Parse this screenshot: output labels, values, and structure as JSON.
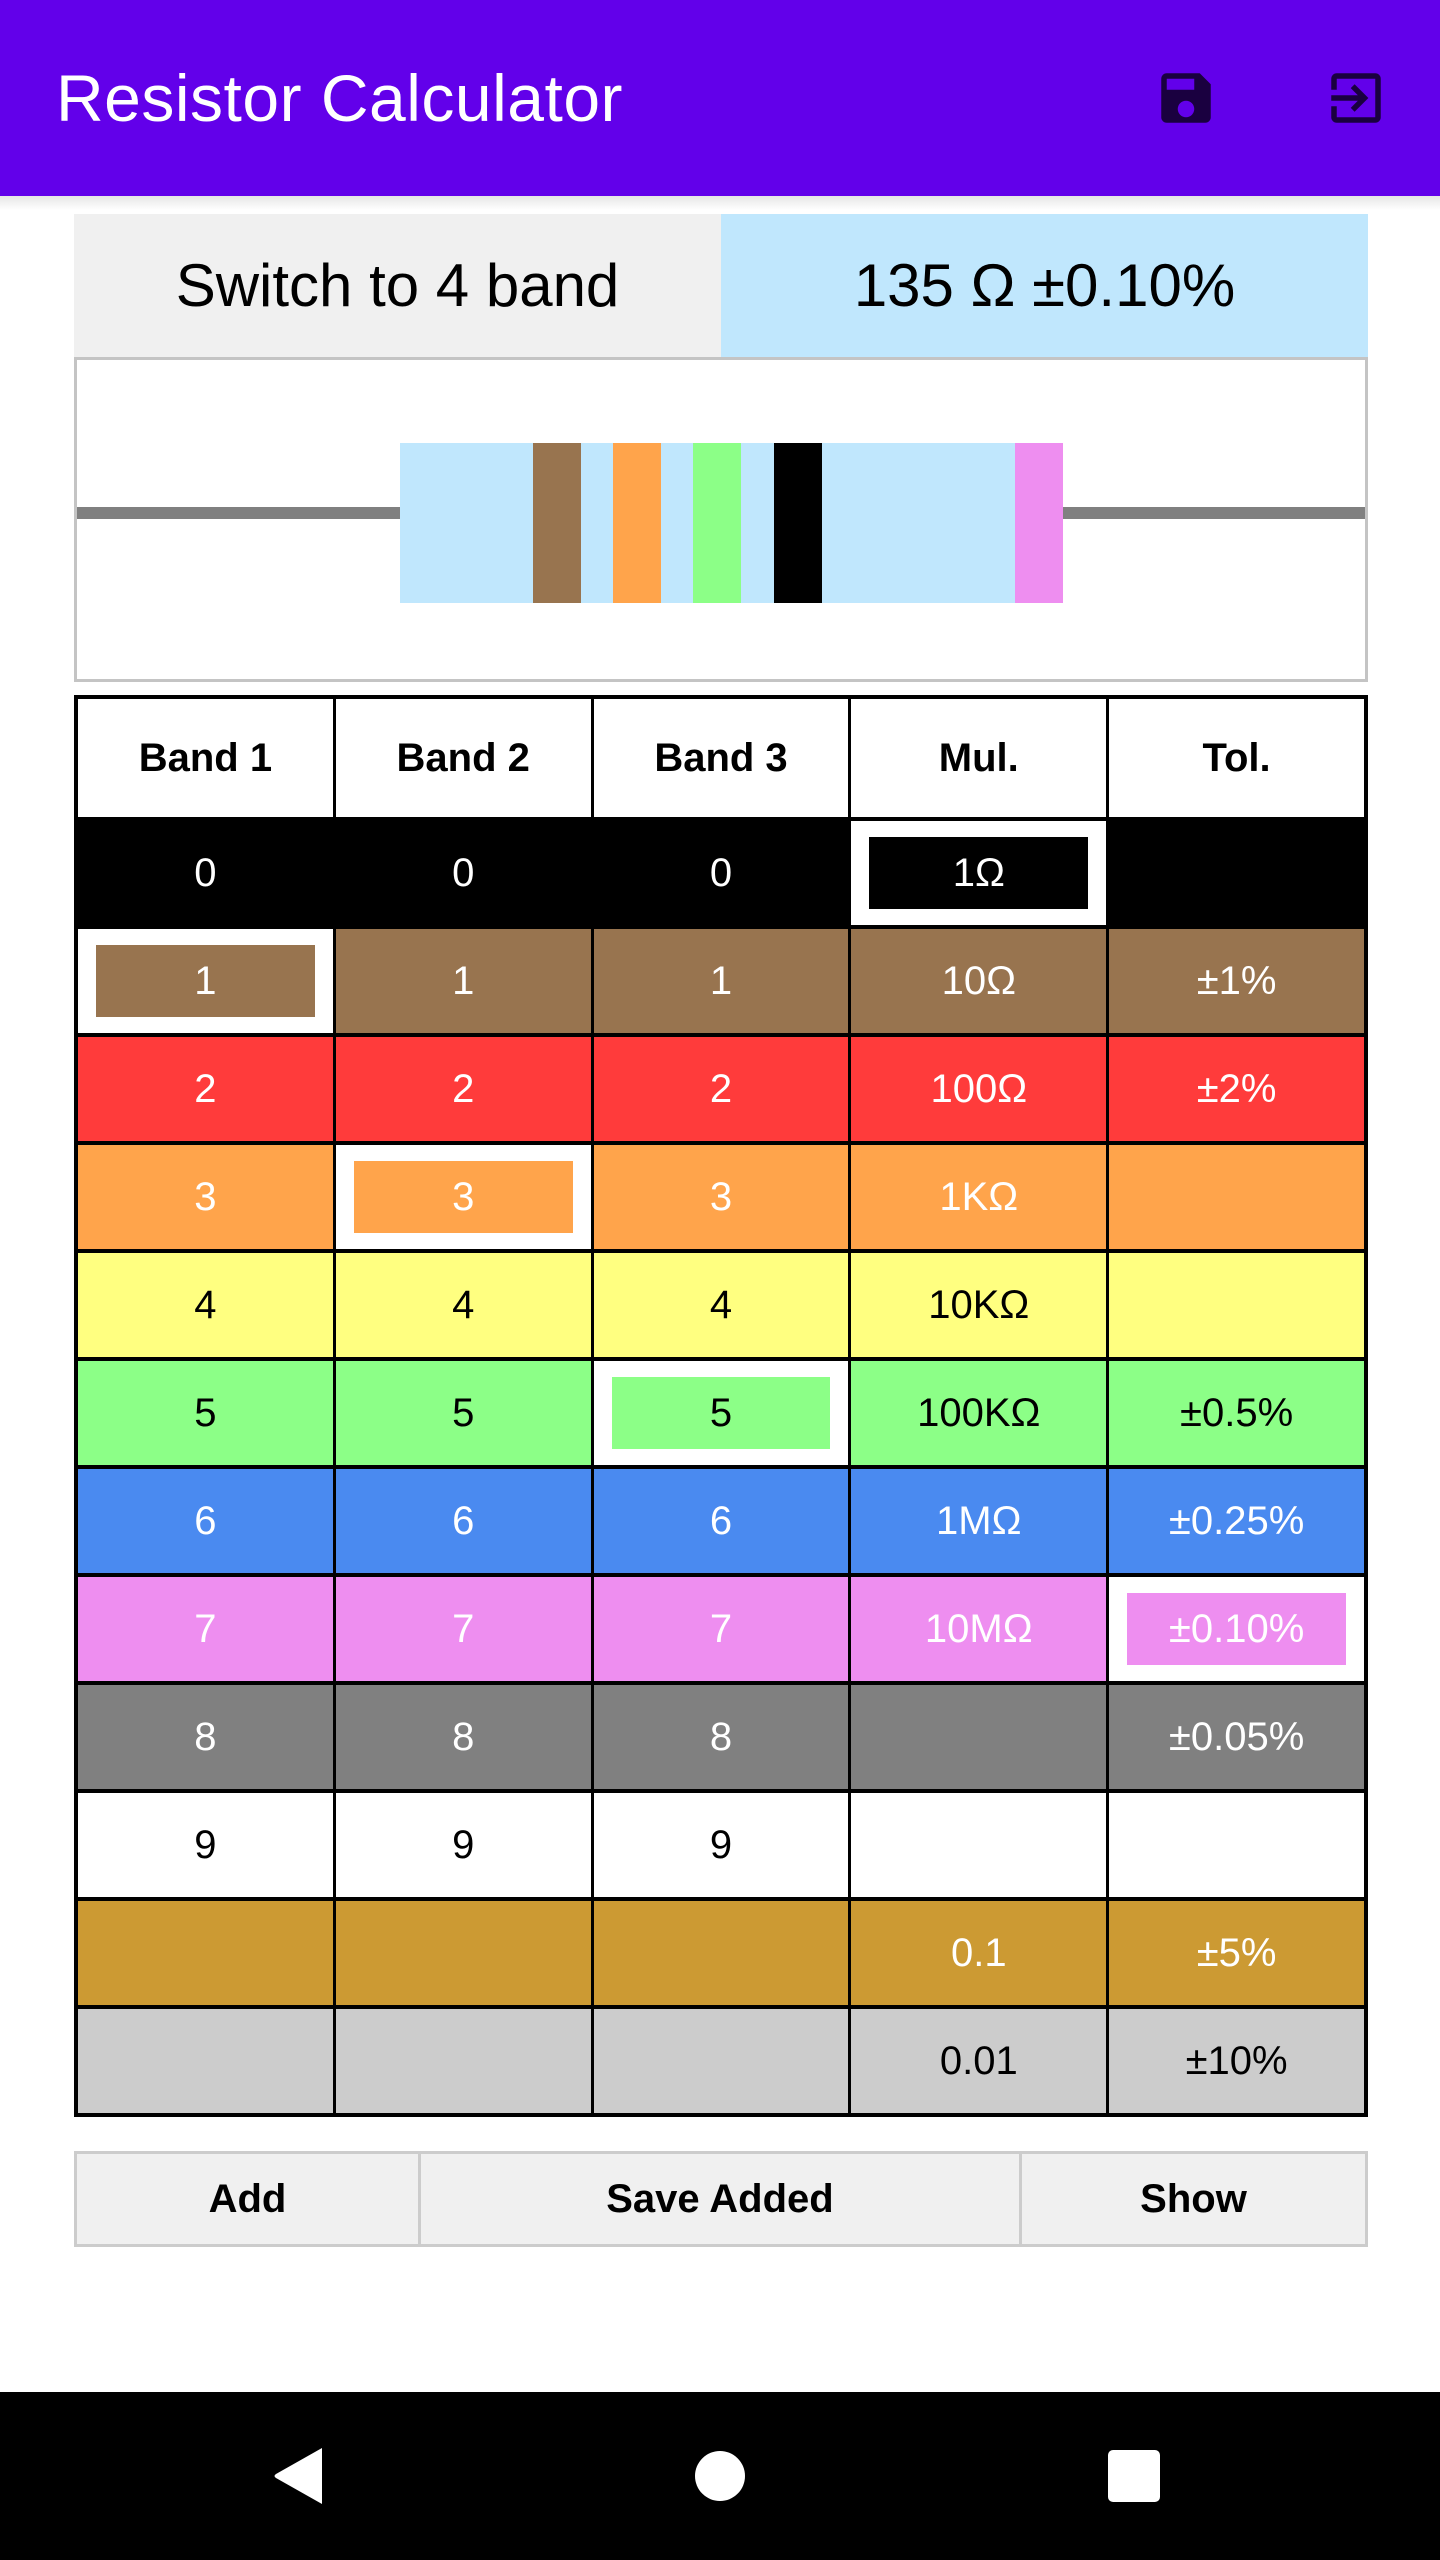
{
  "appbar": {
    "title": "Resistor Calculator",
    "background": "#6200ea",
    "icons": [
      "save-icon",
      "exit-to-app-icon"
    ]
  },
  "top": {
    "switch_label": "Switch to 4 band",
    "result": "135 Ω ±0.10%"
  },
  "resistor": {
    "body_color": "#c0e7fd",
    "lead_color": "#808080",
    "bands": [
      {
        "name": "band-1",
        "color": "#98744f"
      },
      {
        "name": "band-2",
        "color": "#ffa44b"
      },
      {
        "name": "band-3",
        "color": "#8cff87"
      },
      {
        "name": "multiplier",
        "color": "#000000"
      },
      {
        "name": "tolerance",
        "color": "#ee8ef0"
      }
    ]
  },
  "table": {
    "headers": [
      "Band 1",
      "Band 2",
      "Band 3",
      "Mul.",
      "Tol."
    ],
    "rows": [
      {
        "color": "#000000",
        "text_color": "#ffffff",
        "cells": [
          "0",
          "0",
          "0",
          "1Ω",
          ""
        ],
        "selected": [
          3
        ]
      },
      {
        "color": "#98744f",
        "text_color": "#ffffff",
        "cells": [
          "1",
          "1",
          "1",
          "10Ω",
          "±1%"
        ],
        "selected": [
          0
        ]
      },
      {
        "color": "#ff3b3b",
        "text_color": "#ffffff",
        "cells": [
          "2",
          "2",
          "2",
          "100Ω",
          "±2%"
        ],
        "selected": []
      },
      {
        "color": "#ffa44b",
        "text_color": "#ffffff",
        "cells": [
          "3",
          "3",
          "3",
          "1KΩ",
          ""
        ],
        "selected": [
          1
        ]
      },
      {
        "color": "#ffff80",
        "text_color": "#000000",
        "cells": [
          "4",
          "4",
          "4",
          "10KΩ",
          ""
        ],
        "selected": []
      },
      {
        "color": "#8cff87",
        "text_color": "#000000",
        "cells": [
          "5",
          "5",
          "5",
          "100KΩ",
          "±0.5%"
        ],
        "selected": [
          2
        ]
      },
      {
        "color": "#4a8af0",
        "text_color": "#ffffff",
        "cells": [
          "6",
          "6",
          "6",
          "1MΩ",
          "±0.25%"
        ],
        "selected": []
      },
      {
        "color": "#ee8ef0",
        "text_color": "#ffffff",
        "cells": [
          "7",
          "7",
          "7",
          "10MΩ",
          "±0.10%"
        ],
        "selected": [
          4
        ]
      },
      {
        "color": "#808080",
        "text_color": "#ffffff",
        "cells": [
          "8",
          "8",
          "8",
          "",
          "±0.05%"
        ],
        "selected": []
      },
      {
        "color": "#ffffff",
        "text_color": "#000000",
        "cells": [
          "9",
          "9",
          "9",
          "",
          ""
        ],
        "selected": []
      },
      {
        "color": "#cc9a33",
        "text_color": "#ffffff",
        "cells": [
          "",
          "",
          "",
          "0.1",
          "±5%"
        ],
        "selected": []
      },
      {
        "color": "#cccccc",
        "text_color": "#000000",
        "cells": [
          "",
          "",
          "",
          "0.01",
          "±10%"
        ],
        "selected": []
      }
    ]
  },
  "actions": {
    "add": "Add",
    "save_added": "Save Added",
    "show": "Show"
  },
  "navbar": {
    "icons": [
      "back-icon",
      "home-icon",
      "recents-icon"
    ]
  }
}
